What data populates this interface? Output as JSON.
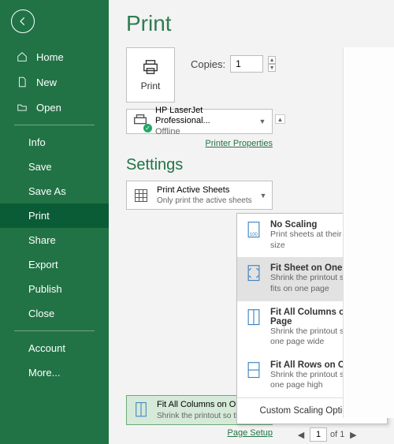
{
  "sidebar": {
    "top_items": [
      {
        "label": "Home",
        "icon": "home-icon"
      },
      {
        "label": "New",
        "icon": "new-icon"
      },
      {
        "label": "Open",
        "icon": "open-icon"
      }
    ],
    "file_items": [
      {
        "label": "Info"
      },
      {
        "label": "Save"
      },
      {
        "label": "Save As"
      },
      {
        "label": "Print",
        "active": true
      },
      {
        "label": "Share"
      },
      {
        "label": "Export"
      },
      {
        "label": "Publish"
      },
      {
        "label": "Close"
      }
    ],
    "bottom_items": [
      {
        "label": "Account"
      },
      {
        "label": "More..."
      }
    ]
  },
  "page": {
    "title": "Print",
    "print_btn": "Print",
    "copies_label": "Copies:",
    "copies_value": "1",
    "printer": {
      "name": "HP LaserJet Professional...",
      "status": "Offline"
    },
    "printer_props": "Printer Properties",
    "settings_header": "Settings",
    "active_sheets": {
      "title": "Print Active Sheets",
      "sub": "Only print the active sheets"
    },
    "selected_scaling": {
      "title": "Fit All Columns on One P...",
      "sub": "Shrink the printout so tha..."
    },
    "page_setup": "Page Setup",
    "page_nav": {
      "value": "1",
      "total": "of 1"
    }
  },
  "scaling_menu": {
    "options": [
      {
        "title": "No Scaling",
        "sub": "Print sheets at their actual size"
      },
      {
        "title": "Fit Sheet on One Page",
        "sub": "Shrink the printout so that it fits on one page",
        "highlight": true
      },
      {
        "title": "Fit All Columns on One Page",
        "sub": "Shrink the printout so that it is one page wide"
      },
      {
        "title": "Fit All Rows on One Page",
        "sub": "Shrink the printout so that it is one page high"
      }
    ],
    "custom": "Custom Scaling Options..."
  }
}
